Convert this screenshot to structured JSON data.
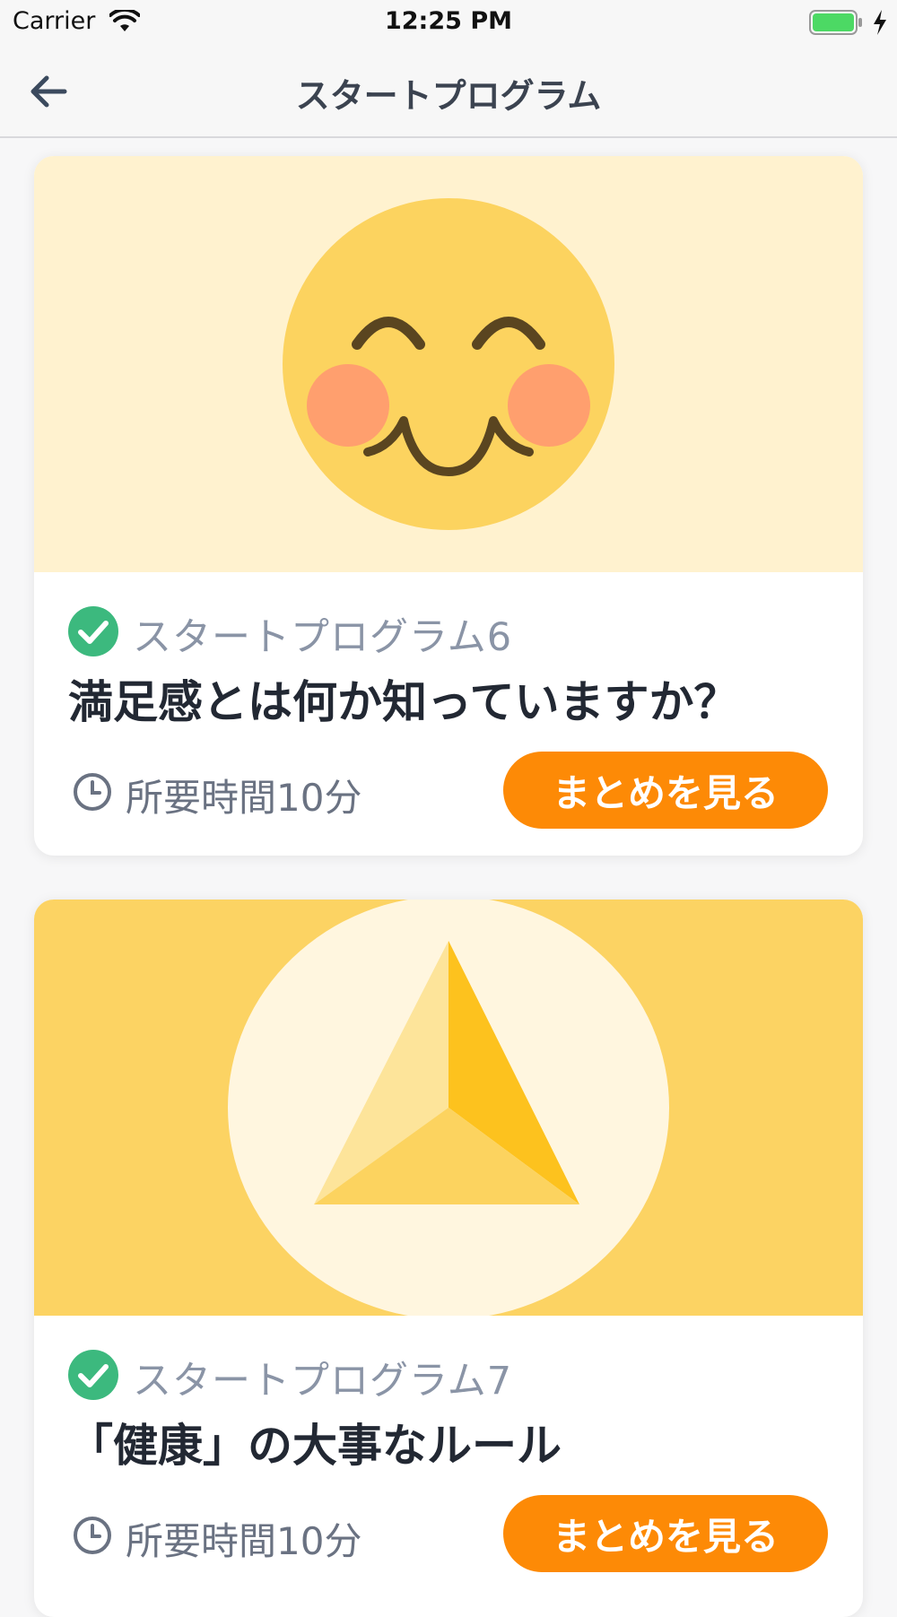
{
  "status_bar": {
    "carrier": "Carrier",
    "time": "12:25 PM",
    "battery_color": "#4cd964"
  },
  "nav": {
    "title": "スタートプログラム",
    "back_icon": "arrow-left-icon"
  },
  "colors": {
    "accent": "#fd8a06",
    "check": "#3cb97e",
    "label": "#8a94a6",
    "title": "#222833"
  },
  "cards": [
    {
      "image_icon": "blushing-smile-face",
      "image_bg": "#fff2cf",
      "completed": true,
      "label": "スタートプログラム6",
      "title": "満足感とは何か知っていますか？",
      "duration": "所要時間10分",
      "button": "まとめを見る"
    },
    {
      "image_icon": "golden-triangle-pyramid",
      "image_bg": "#fcd363",
      "completed": true,
      "label": "スタートプログラム7",
      "title": "「健康」の大事なルール",
      "duration": "所要時間10分",
      "button": "まとめを見る"
    }
  ]
}
